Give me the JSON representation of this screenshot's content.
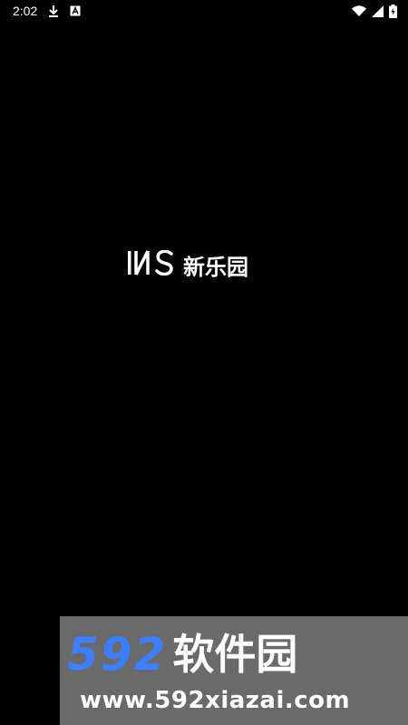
{
  "status_bar": {
    "time": "2:02",
    "icons": [
      "download-icon",
      "keyboard-a-icon",
      "wifi-icon",
      "signal-icon",
      "battery-charging-icon"
    ]
  },
  "splash": {
    "logo_mark": "INS",
    "logo_text": "新乐园"
  },
  "watermark": {
    "number": "592",
    "name": "软件园",
    "url": "www.592xiazai.com"
  },
  "colors": {
    "background": "#000000",
    "text": "#ffffff",
    "watermark_bg": "#6a6a6a",
    "watermark_accent": "#3a7fff"
  }
}
